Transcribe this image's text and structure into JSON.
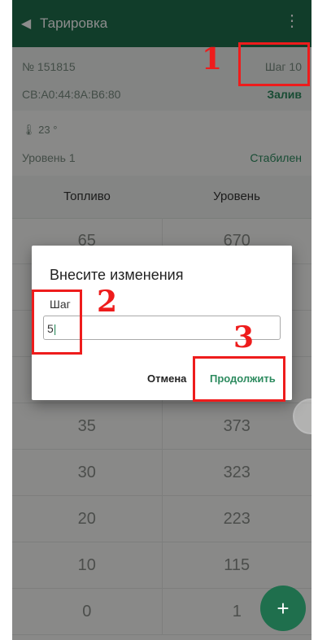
{
  "appbar": {
    "title": "Тарировка",
    "back_icon": "back-arrow-icon",
    "menu_icon": "overflow-menu-icon"
  },
  "info": {
    "serial": "№ 151815",
    "mac": "CB:A0:44:8A:B6:80",
    "step": "Шаг 10",
    "mode": "Залив"
  },
  "status": {
    "temperature": "23 °",
    "level": "Уровень 1",
    "state": "Стабилен"
  },
  "table": {
    "headers": [
      "Топливо",
      "Уровень"
    ],
    "rows": [
      [
        "65",
        "670"
      ],
      [
        "",
        ""
      ],
      [
        "",
        ""
      ],
      [
        "",
        ""
      ],
      [
        "35",
        "373"
      ],
      [
        "30",
        "323"
      ],
      [
        "20",
        "223"
      ],
      [
        "10",
        "115"
      ],
      [
        "0",
        "1"
      ]
    ]
  },
  "dialog": {
    "title": "Внесите изменения",
    "field_label": "Шаг",
    "field_value": "5",
    "cancel": "Отмена",
    "continue": "Продолжить"
  },
  "annotations": {
    "n1": "1",
    "n2": "2",
    "n3": "3",
    "color": "#ee1c1c"
  },
  "colors": {
    "primary": "#1f6f4d",
    "accent": "#2d8b5f"
  }
}
